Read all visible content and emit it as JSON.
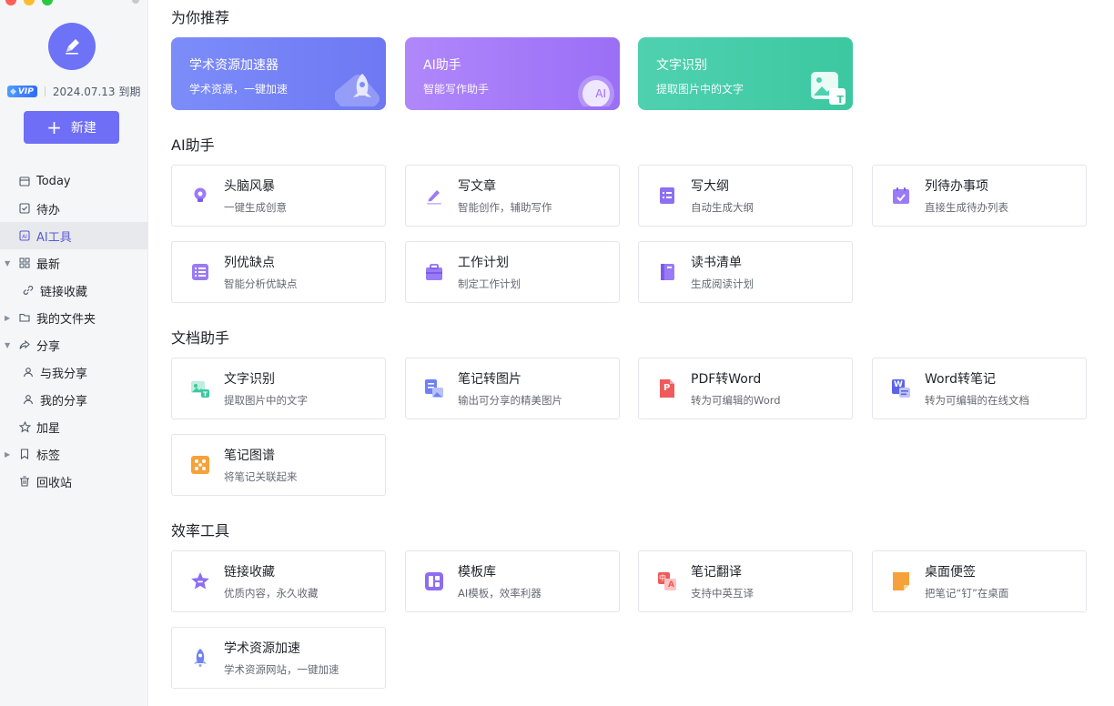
{
  "sidebar": {
    "vip_label": "VIP",
    "expiry": "2024.07.13 到期",
    "new_button": "新建",
    "items": [
      {
        "label": "Today",
        "icon": "calendar-icon"
      },
      {
        "label": "待办",
        "icon": "checkbox-icon"
      },
      {
        "label": "AI工具",
        "icon": "ai-icon"
      },
      {
        "label": "最新",
        "icon": "grid-icon"
      },
      {
        "label": "链接收藏",
        "icon": "link-icon"
      },
      {
        "label": "我的文件夹",
        "icon": "folder-icon"
      },
      {
        "label": "分享",
        "icon": "share-icon"
      },
      {
        "label": "与我分享",
        "icon": "person-icon"
      },
      {
        "label": "我的分享",
        "icon": "person-icon"
      },
      {
        "label": "加星",
        "icon": "star-icon"
      },
      {
        "label": "标签",
        "icon": "bookmark-icon"
      },
      {
        "label": "回收站",
        "icon": "trash-icon"
      }
    ]
  },
  "sections": {
    "recommend": "为你推荐",
    "ai": "AI助手",
    "doc": "文档助手",
    "efficiency": "效率工具"
  },
  "promos": [
    {
      "title": "学术资源加速器",
      "subtitle": "学术资源，一键加速"
    },
    {
      "title": "AI助手",
      "subtitle": "智能写作助手",
      "badge": "AI"
    },
    {
      "title": "文字识别",
      "subtitle": "提取图片中的文字",
      "badge": "T"
    }
  ],
  "ai_tools": [
    {
      "title": "头脑风暴",
      "subtitle": "一键生成创意",
      "icon": "lightbulb-icon"
    },
    {
      "title": "写文章",
      "subtitle": "智能创作，辅助写作",
      "icon": "pen-icon"
    },
    {
      "title": "写大纲",
      "subtitle": "自动生成大纲",
      "icon": "outline-icon"
    },
    {
      "title": "列待办事项",
      "subtitle": "直接生成待办列表",
      "icon": "calendar-check-icon"
    },
    {
      "title": "列优缺点",
      "subtitle": "智能分析优缺点",
      "icon": "list-icon"
    },
    {
      "title": "工作计划",
      "subtitle": "制定工作计划",
      "icon": "briefcase-icon"
    },
    {
      "title": "读书清单",
      "subtitle": "生成阅读计划",
      "icon": "book-icon"
    }
  ],
  "doc_tools": [
    {
      "title": "文字识别",
      "subtitle": "提取图片中的文字",
      "icon": "image-text-icon"
    },
    {
      "title": "笔记转图片",
      "subtitle": "输出可分享的精美图片",
      "icon": "note-image-icon"
    },
    {
      "title": "PDF转Word",
      "subtitle": "转为可编辑的Word",
      "icon": "pdf-icon",
      "glyph": "P"
    },
    {
      "title": "Word转笔记",
      "subtitle": "转为可编辑的在线文档",
      "icon": "word-icon",
      "glyph": "W"
    },
    {
      "title": "笔记图谱",
      "subtitle": "将笔记关联起来",
      "icon": "graph-icon"
    }
  ],
  "eff_tools": [
    {
      "title": "链接收藏",
      "subtitle": "优质内容，永久收藏",
      "icon": "star-badge-icon"
    },
    {
      "title": "模板库",
      "subtitle": "AI模板，效率利器",
      "icon": "template-icon"
    },
    {
      "title": "笔记翻译",
      "subtitle": "支持中英互译",
      "icon": "translate-icon",
      "glyph1": "中",
      "glyph2": "A"
    },
    {
      "title": "桌面便签",
      "subtitle": "把笔记“钉”在桌面",
      "icon": "sticky-note-icon"
    },
    {
      "title": "学术资源加速",
      "subtitle": "学术资源网站，一键加速",
      "icon": "rocket-icon"
    }
  ]
}
